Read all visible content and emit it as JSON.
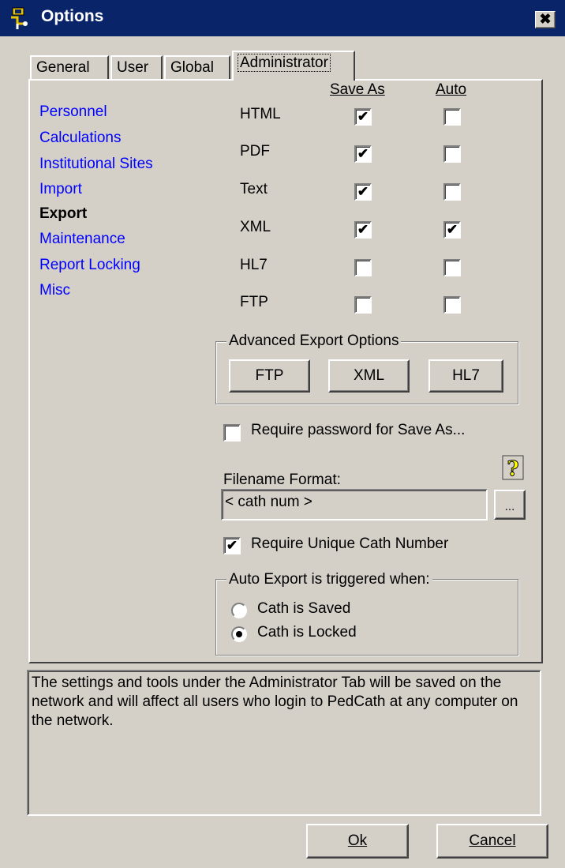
{
  "window": {
    "title": "Options",
    "close_glyph": "✖"
  },
  "tabs": [
    {
      "label": "General"
    },
    {
      "label": "User"
    },
    {
      "label": "Global"
    },
    {
      "label": "Administrator",
      "active": true
    }
  ],
  "sidebar": {
    "items": [
      {
        "label": "Personnel"
      },
      {
        "label": "Calculations"
      },
      {
        "label": "Institutional Sites"
      },
      {
        "label": "Import"
      },
      {
        "label": "Export",
        "selected": true
      },
      {
        "label": "Maintenance"
      },
      {
        "label": "Report Locking"
      },
      {
        "label": "Misc"
      }
    ]
  },
  "export": {
    "columns": {
      "save_as": "Save As",
      "auto": "Auto"
    },
    "formats": [
      {
        "label": "HTML",
        "save_as": true,
        "auto": false
      },
      {
        "label": "PDF",
        "save_as": true,
        "auto": false
      },
      {
        "label": "Text",
        "save_as": true,
        "auto": false
      },
      {
        "label": "XML",
        "save_as": true,
        "auto": true
      },
      {
        "label": "HL7",
        "save_as": false,
        "auto": false
      },
      {
        "label": "FTP",
        "save_as": false,
        "auto": false
      }
    ],
    "checkmark": "✔",
    "advanced": {
      "caption": "Advanced Export Options",
      "buttons": [
        "FTP",
        "XML",
        "HL7"
      ]
    },
    "require_password": {
      "label": "Require password for Save As...",
      "checked": false
    },
    "filename_format": {
      "label": "Filename Format:",
      "value": "< cath num >",
      "browse_label": "..."
    },
    "require_unique": {
      "label": "Require Unique Cath Number",
      "checked": true
    },
    "auto_trigger": {
      "caption": "Auto Export is triggered when:",
      "options": [
        {
          "label": "Cath is Saved",
          "selected": false
        },
        {
          "label": "Cath is Locked",
          "selected": true
        }
      ]
    }
  },
  "info_text": "The settings and tools under the Administrator Tab will be saved on the network and will affect all users who login to PedCath at any computer on the network.",
  "footer": {
    "ok_label": "Ok",
    "cancel_label": "Cancel"
  },
  "colors": {
    "titlebar": "#0a246a",
    "link": "#0000ff",
    "face": "#d4d0c8"
  },
  "icons": {
    "title": "app-icon",
    "help": "help-question-icon"
  }
}
